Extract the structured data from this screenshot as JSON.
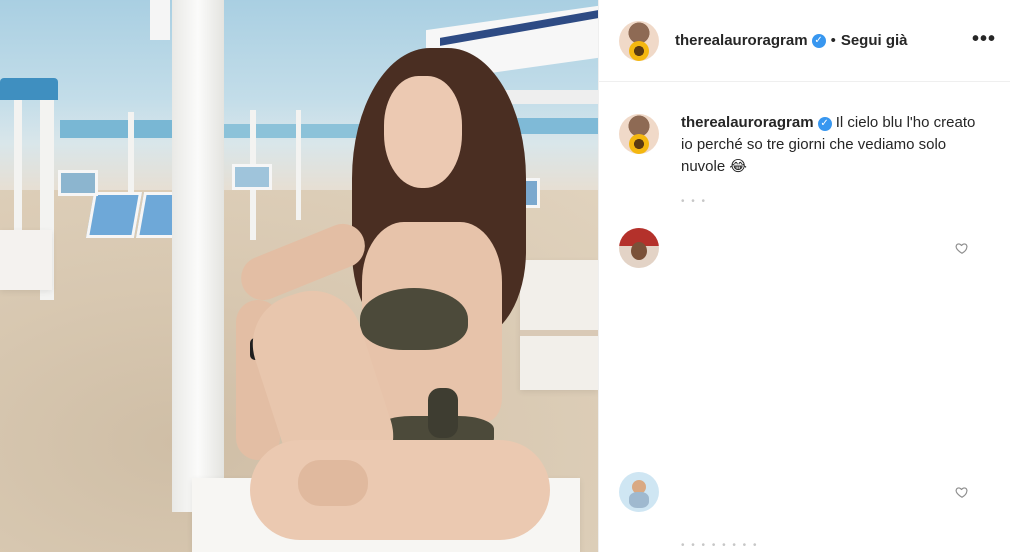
{
  "header": {
    "username": "therealauroragram",
    "separator": "•",
    "follow_label": "Segui già",
    "more_label": "•••",
    "icons": {
      "verified": "verified-badge-icon",
      "more": "more-options-icon"
    }
  },
  "caption": {
    "username": "therealauroragram",
    "text": "Il cielo blu l'ho creato io perché so tre giorni che vediamo solo nuvole 😂"
  },
  "comments": [
    {
      "id": "comment-1",
      "avatar_icon": "user-avatar"
    },
    {
      "id": "comment-2",
      "avatar_icon": "user-avatar"
    }
  ],
  "colors": {
    "verified": "#3897f0",
    "text": "#262626",
    "border": "#efefef",
    "muted": "#c7c7c7"
  }
}
